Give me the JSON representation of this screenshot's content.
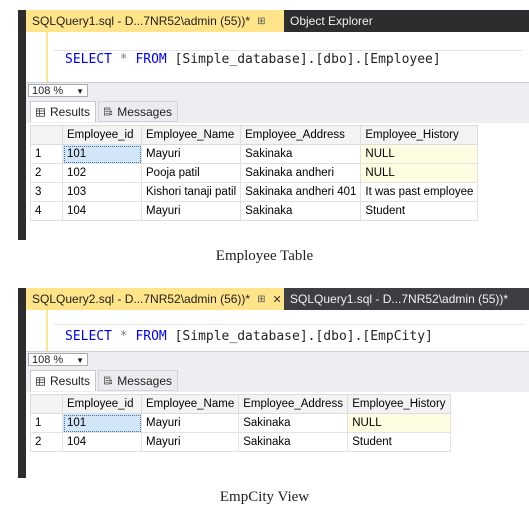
{
  "window1": {
    "tabs": [
      {
        "label": "SQLQuery1.sql - D...7NR52\\admin (55))*",
        "pin": "⊞"
      },
      {
        "label": "Object Explorer"
      }
    ],
    "query": {
      "kw1": "SELECT",
      "star": "*",
      "kw2": "FROM",
      "object": "[Simple_database].[dbo].[Employee]"
    },
    "zoom": "108 %",
    "result_tabs": [
      "Results",
      "Messages"
    ],
    "columns": [
      "Employee_id",
      "Employee_Name",
      "Employee_Address",
      "Employee_History"
    ],
    "rows": [
      {
        "n": "1",
        "id": "101",
        "name": "Mayuri",
        "address": "Sakinaka",
        "history": "NULL"
      },
      {
        "n": "2",
        "id": "102",
        "name": "Pooja patil",
        "address": "Sakinaka andheri",
        "history": "NULL"
      },
      {
        "n": "3",
        "id": "103",
        "name": "Kishori tanaji patil",
        "address": "Sakinaka andheri 401",
        "history": "It was past employee"
      },
      {
        "n": "4",
        "id": "104",
        "name": "Mayuri",
        "address": "Sakinaka",
        "history": "Student"
      }
    ],
    "caption": "Employee Table"
  },
  "window2": {
    "tabs": [
      {
        "label": "SQLQuery2.sql - D...7NR52\\admin (56))*",
        "pin": "⊞",
        "close": "✕"
      },
      {
        "label": "SQLQuery1.sql - D...7NR52\\admin (55))*"
      }
    ],
    "query": {
      "kw1": "SELECT",
      "star": "*",
      "kw2": "FROM",
      "object": "[Simple_database].[dbo].[EmpCity]"
    },
    "zoom": "108 %",
    "result_tabs": [
      "Results",
      "Messages"
    ],
    "columns": [
      "Employee_id",
      "Employee_Name",
      "Employee_Address",
      "Employee_History"
    ],
    "rows": [
      {
        "n": "1",
        "id": "101",
        "name": "Mayuri",
        "address": "Sakinaka",
        "history": "NULL"
      },
      {
        "n": "2",
        "id": "104",
        "name": "Mayuri",
        "address": "Sakinaka",
        "history": "Student"
      }
    ],
    "caption": "EmpCity View"
  },
  "icons": {
    "results": "grid-icon",
    "messages": "messages-icon",
    "zoom_dropdown": "chevron-down-icon",
    "pin": "pin-icon",
    "close": "close-icon"
  },
  "colors": {
    "active_tab": "#ffe48a",
    "dark_chrome": "#2d2d30",
    "keyword": "#0000ff",
    "selected_cell": "#d3e6f8",
    "null_cell": "#fffde1"
  }
}
